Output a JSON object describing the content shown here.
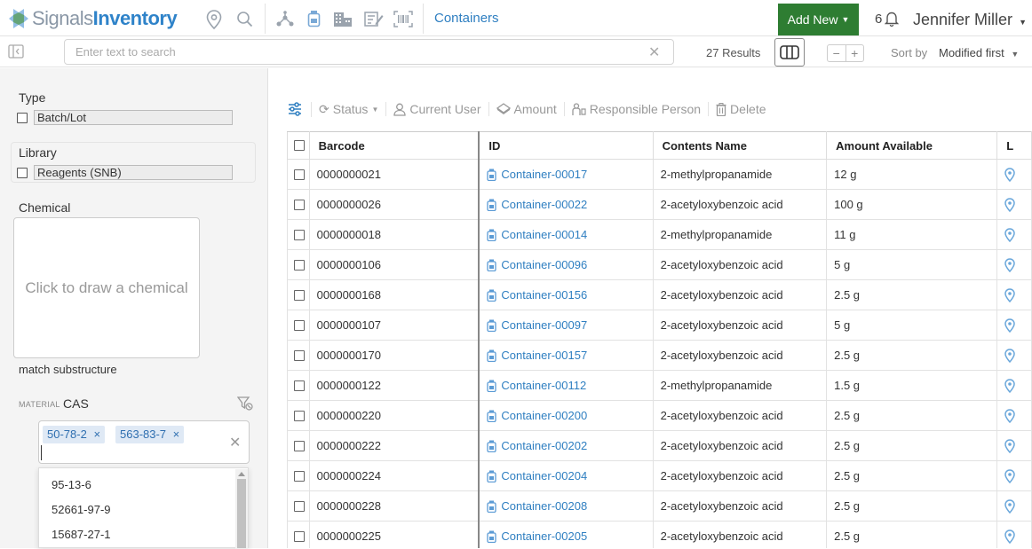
{
  "app": {
    "logo_part1": "Signals",
    "logo_part2": "Inventory",
    "breadcrumb": "Containers",
    "add_new_label": "Add New",
    "notification_count": "6",
    "user_name": "Jennifer Miller"
  },
  "search": {
    "placeholder": "Enter text to search",
    "value": "",
    "results_text": "27 Results",
    "sort_label": "Sort by",
    "sort_value": "Modified first",
    "zoom_minus": "−",
    "zoom_plus": "+"
  },
  "filters": {
    "type_label": "Type",
    "type_option": "Batch/Lot",
    "library_label": "Library",
    "library_option": "Reagents (SNB)",
    "chemical_label": "Chemical",
    "chemical_placeholder": "Click to draw a chemical",
    "match_substructure": "match substructure",
    "cas_prefix": "MATERIAL",
    "cas_label": "CAS",
    "cas_tags": [
      "50-78-2",
      "563-83-7"
    ],
    "cas_dropdown": [
      "95-13-6",
      "52661-97-9",
      "15687-27-1"
    ]
  },
  "toolbar": {
    "status": "Status",
    "current_user": "Current User",
    "amount": "Amount",
    "responsible_person": "Responsible Person",
    "delete": "Delete"
  },
  "table": {
    "columns": [
      "Barcode",
      "ID",
      "Contents Name",
      "Amount Available",
      "L"
    ],
    "rows": [
      {
        "barcode": "0000000021",
        "id": "Container-00017",
        "contents": "2-methylpropanamide",
        "amount": "12 g"
      },
      {
        "barcode": "0000000026",
        "id": "Container-00022",
        "contents": "2-acetyloxybenzoic acid",
        "amount": "100 g"
      },
      {
        "barcode": "0000000018",
        "id": "Container-00014",
        "contents": "2-methylpropanamide",
        "amount": "11 g"
      },
      {
        "barcode": "0000000106",
        "id": "Container-00096",
        "contents": "2-acetyloxybenzoic acid",
        "amount": "5 g"
      },
      {
        "barcode": "0000000168",
        "id": "Container-00156",
        "contents": "2-acetyloxybenzoic acid",
        "amount": "2.5 g"
      },
      {
        "barcode": "0000000107",
        "id": "Container-00097",
        "contents": "2-acetyloxybenzoic acid",
        "amount": "5 g"
      },
      {
        "barcode": "0000000170",
        "id": "Container-00157",
        "contents": "2-acetyloxybenzoic acid",
        "amount": "2.5 g"
      },
      {
        "barcode": "0000000122",
        "id": "Container-00112",
        "contents": "2-methylpropanamide",
        "amount": "1.5 g"
      },
      {
        "barcode": "0000000220",
        "id": "Container-00200",
        "contents": "2-acetyloxybenzoic acid",
        "amount": "2.5 g"
      },
      {
        "barcode": "0000000222",
        "id": "Container-00202",
        "contents": "2-acetyloxybenzoic acid",
        "amount": "2.5 g"
      },
      {
        "barcode": "0000000224",
        "id": "Container-00204",
        "contents": "2-acetyloxybenzoic acid",
        "amount": "2.5 g"
      },
      {
        "barcode": "0000000228",
        "id": "Container-00208",
        "contents": "2-acetyloxybenzoic acid",
        "amount": "2.5 g"
      },
      {
        "barcode": "0000000225",
        "id": "Container-00205",
        "contents": "2-acetyloxybenzoic acid",
        "amount": "2.5 g"
      }
    ]
  },
  "colors": {
    "brand_blue": "#2f83c9",
    "add_new_green": "#2e7d32",
    "link_blue": "#2f7fc1"
  }
}
